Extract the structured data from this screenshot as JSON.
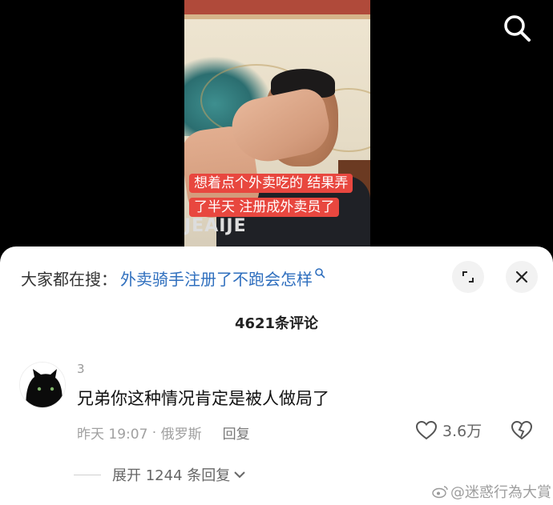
{
  "video": {
    "caption": "想着点个外卖吃的 结果弄了半天 注册成外卖员了",
    "shirt_print": "JEAIJE"
  },
  "search": {
    "icon": "search-icon"
  },
  "sheet": {
    "suggest_prefix": "大家都在搜：",
    "suggest_query": "外卖骑手注册了不跑会怎样",
    "comment_count": "4621条评论",
    "expand_icon": "expand-icon",
    "close_icon": "close-icon"
  },
  "comment": {
    "author": "3",
    "text": "兄弟你这种情况肯定是被人做局了",
    "time": "昨天 19:07",
    "location": "俄罗斯",
    "reply_label": "回复",
    "like_count": "3.6万",
    "expand_replies": "展开 1244 条回复"
  },
  "watermark": {
    "text": "@迷惑行為大賞"
  }
}
